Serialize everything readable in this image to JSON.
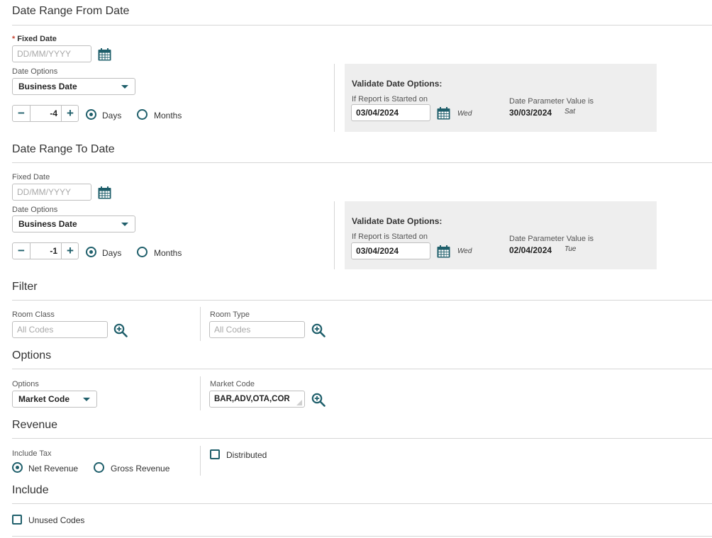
{
  "sections": {
    "from": "Date Range From Date",
    "to": "Date Range To Date",
    "filter": "Filter",
    "options": "Options",
    "revenue": "Revenue",
    "include": "Include"
  },
  "from": {
    "fixed_label": "Fixed Date",
    "required_mark": "*",
    "fixed_placeholder": "DD/MM/YYYY",
    "date_options_label": "Date Options",
    "date_option_value": "Business Date",
    "offset": "-4",
    "minus": "−",
    "plus": "+",
    "days": "Days",
    "months": "Months",
    "selected_unit": "Days",
    "validate": {
      "title": "Validate Date Options:",
      "started_label": "If Report is Started on",
      "started_value": "03/04/2024",
      "started_day": "Wed",
      "param_label": "Date Parameter Value is",
      "param_value": "30/03/2024",
      "param_day": "Sat"
    }
  },
  "to": {
    "fixed_label": "Fixed Date",
    "fixed_placeholder": "DD/MM/YYYY",
    "date_options_label": "Date Options",
    "date_option_value": "Business Date",
    "offset": "-1",
    "minus": "−",
    "plus": "+",
    "days": "Days",
    "months": "Months",
    "selected_unit": "Days",
    "validate": {
      "title": "Validate Date Options:",
      "started_label": "If Report is Started on",
      "started_value": "03/04/2024",
      "started_day": "Wed",
      "param_label": "Date Parameter Value is",
      "param_value": "02/04/2024",
      "param_day": "Tue"
    }
  },
  "filter": {
    "room_class_label": "Room Class",
    "room_class_placeholder": "All Codes",
    "room_type_label": "Room Type",
    "room_type_placeholder": "All Codes"
  },
  "options": {
    "options_label": "Options",
    "options_value": "Market Code",
    "market_code_label": "Market Code",
    "market_code_value": "BAR,ADV,OTA,COR"
  },
  "revenue": {
    "include_tax_label": "Include Tax",
    "net": "Net Revenue",
    "gross": "Gross Revenue",
    "selected": "Net Revenue",
    "distributed": "Distributed",
    "distributed_checked": false
  },
  "include": {
    "unused_codes": "Unused Codes",
    "unused_codes_checked": false
  },
  "colors": {
    "accent": "#1f5f6b",
    "required": "#c74634",
    "panel": "#eeeeee"
  }
}
